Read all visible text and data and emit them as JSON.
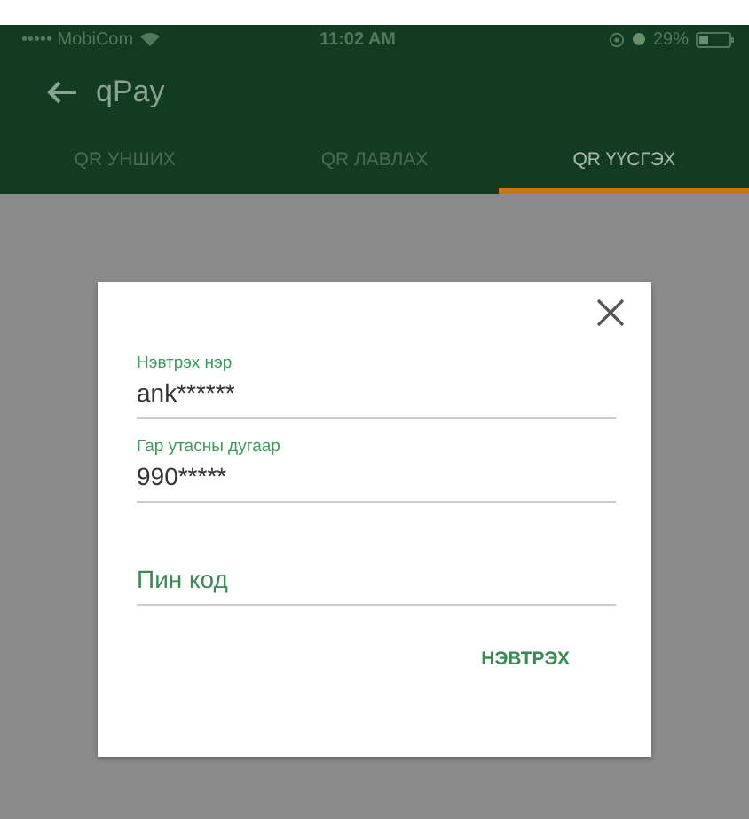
{
  "status_bar": {
    "carrier": "••••• MobiCom",
    "time": "11:02 AM",
    "battery": "29%"
  },
  "app_bar": {
    "title": "qPay"
  },
  "tabs": [
    {
      "label": "QR УНШИХ",
      "selected": false
    },
    {
      "label": "QR ЛАВЛАХ",
      "selected": false
    },
    {
      "label": "QR ҮҮСГЭХ",
      "selected": true
    }
  ],
  "dialog": {
    "fields": [
      {
        "label": "Нэвтрэх нэр",
        "value": "ank******"
      },
      {
        "label": "Гар утасны дугаар",
        "value": "990*****"
      },
      {
        "placeholder": "Пин код"
      }
    ],
    "button": "НЭВТРЭХ"
  }
}
